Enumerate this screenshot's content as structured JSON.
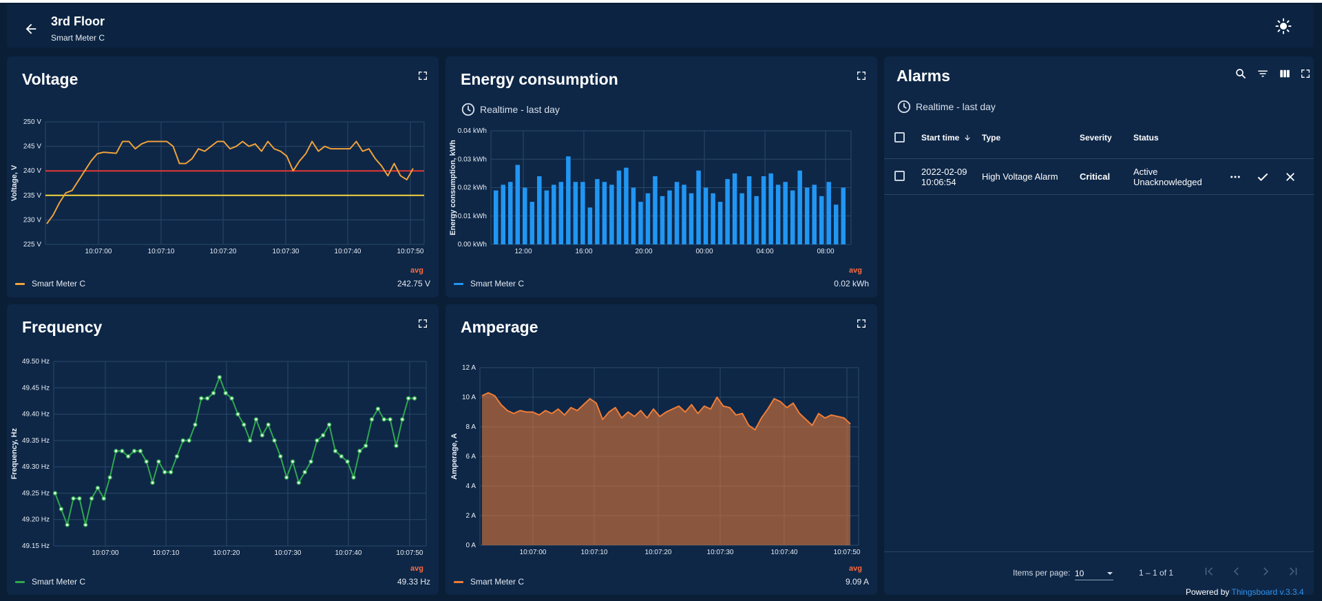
{
  "header": {
    "title": "3rd Floor",
    "subtitle": "Smart Meter C"
  },
  "voltage": {
    "title": "Voltage",
    "legend_name": "Smart Meter C",
    "avg_label": "avg",
    "avg_value": "242.75 V",
    "colors": {
      "line": "#f0a23a",
      "threshold_high": "#e53935",
      "threshold_low": "#f5d63d"
    }
  },
  "energy": {
    "title": "Energy consumption",
    "timewindow": "Realtime - last day",
    "legend_name": "Smart Meter C",
    "avg_label": "avg",
    "avg_value": "0.02 kWh",
    "color": "#2196f3"
  },
  "frequency": {
    "title": "Frequency",
    "legend_name": "Smart Meter C",
    "avg_label": "avg",
    "avg_value": "49.33 Hz",
    "color": "#2fa84f"
  },
  "amperage": {
    "title": "Amperage",
    "legend_name": "Smart Meter C",
    "avg_label": "avg",
    "avg_value": "9.09 A",
    "color": "#f07d37"
  },
  "alarms": {
    "title": "Alarms",
    "timewindow": "Realtime - last day",
    "columns": [
      "Start time",
      "Type",
      "Severity",
      "Status"
    ],
    "rows": [
      {
        "date": "2022-02-09",
        "time": "10:06:54",
        "type": "High Voltage Alarm",
        "severity": "Critical",
        "status_1": "Active",
        "status_2": "Unacknowledged"
      }
    ],
    "pager": {
      "items_per_page_label": "Items per page:",
      "items_per_page": "10",
      "range": "1 – 1 of 1"
    }
  },
  "footer": {
    "powered_prefix": "Powered by",
    "powered_link": "Thingsboard v.3.3.4"
  },
  "chart_data": [
    {
      "type": "line",
      "title": "Voltage",
      "ylabel": "Voltage, V",
      "ylim": [
        225,
        250
      ],
      "yticks": [
        "225 V",
        "230 V",
        "235 V",
        "240 V",
        "245 V",
        "250 V"
      ],
      "xticks": [
        "10:07:00",
        "10:07:10",
        "10:07:20",
        "10:07:30",
        "10:07:40",
        "10:07:50"
      ],
      "x_range": [
        "10:06:52",
        "10:07:51"
      ],
      "series": [
        {
          "name": "Smart Meter C",
          "values": [
            229.2,
            231,
            233.5,
            235.5,
            236,
            238,
            240,
            242,
            243.5,
            243.8,
            243.7,
            243.6,
            246,
            246,
            244.5,
            245.5,
            246,
            246,
            246,
            246,
            245,
            241.5,
            241.5,
            242.5,
            244.5,
            244,
            245,
            246,
            246,
            244.5,
            245,
            246,
            245,
            245.5,
            244,
            246,
            244.5,
            244,
            243,
            240,
            242,
            243.5,
            246,
            244,
            245,
            244.5,
            244.5,
            244.5,
            244.5,
            246,
            244,
            244.5,
            242.5,
            241,
            239,
            241.5,
            239,
            238.2,
            240.5
          ]
        }
      ],
      "thresholds": [
        240,
        235
      ],
      "grid": true,
      "legend": "bottom"
    },
    {
      "type": "bar",
      "title": "Energy consumption",
      "ylabel": "Energy consumption, kWh",
      "ylim": [
        0,
        0.04
      ],
      "yticks": [
        "0.00 kWh",
        "0.01 kWh",
        "0.02 kWh",
        "0.03 kWh",
        "0.04 kWh"
      ],
      "xticks": [
        "12:00",
        "16:00",
        "20:00",
        "00:00",
        "04:00",
        "08:00"
      ],
      "series": [
        {
          "name": "Smart Meter C",
          "values": [
            0.019,
            0.021,
            0.022,
            0.028,
            0.02,
            0.015,
            0.024,
            0.019,
            0.021,
            0.022,
            0.031,
            0.022,
            0.022,
            0.013,
            0.023,
            0.022,
            0.021,
            0.026,
            0.027,
            0.02,
            0.015,
            0.018,
            0.024,
            0.017,
            0.019,
            0.022,
            0.021,
            0.018,
            0.026,
            0.02,
            0.018,
            0.015,
            0.023,
            0.025,
            0.018,
            0.024,
            0.017,
            0.024,
            0.025,
            0.021,
            0.022,
            0.019,
            0.026,
            0.02,
            0.021,
            0.017,
            0.022,
            0.014,
            0.02
          ]
        }
      ],
      "grid": true,
      "legend": "bottom"
    },
    {
      "type": "line",
      "title": "Frequency",
      "ylabel": "Frequency, Hz",
      "ylim": [
        49.15,
        49.5
      ],
      "yticks": [
        "49.15 Hz",
        "49.20 Hz",
        "49.25 Hz",
        "49.30 Hz",
        "49.35 Hz",
        "49.40 Hz",
        "49.45 Hz",
        "49.50 Hz"
      ],
      "xticks": [
        "10:07:00",
        "10:07:10",
        "10:07:20",
        "10:07:30",
        "10:07:40",
        "10:07:50"
      ],
      "series": [
        {
          "name": "Smart Meter C",
          "values": [
            49.25,
            49.22,
            49.19,
            49.24,
            49.24,
            49.19,
            49.24,
            49.26,
            49.24,
            49.28,
            49.33,
            49.33,
            49.32,
            49.33,
            49.33,
            49.31,
            49.27,
            49.31,
            49.29,
            49.29,
            49.32,
            49.35,
            49.35,
            49.38,
            49.43,
            49.43,
            49.44,
            49.47,
            49.44,
            49.43,
            49.4,
            49.38,
            49.35,
            49.39,
            49.36,
            49.38,
            49.35,
            49.32,
            49.28,
            49.31,
            49.27,
            49.29,
            49.31,
            49.35,
            49.36,
            49.38,
            49.33,
            49.32,
            49.31,
            49.28,
            49.33,
            49.34,
            49.39,
            49.41,
            49.39,
            49.39,
            49.34,
            49.39,
            49.43,
            49.43
          ]
        }
      ],
      "grid": true,
      "legend": "bottom"
    },
    {
      "type": "area",
      "title": "Amperage",
      "ylabel": "Amperage, A",
      "ylim": [
        0,
        12
      ],
      "yticks": [
        "0 A",
        "2 A",
        "4 A",
        "6 A",
        "8 A",
        "10 A",
        "12 A"
      ],
      "xticks": [
        "10:07:00",
        "10:07:10",
        "10:07:20",
        "10:07:30",
        "10:07:40",
        "10:07:50"
      ],
      "series": [
        {
          "name": "Smart Meter C",
          "values": [
            10.1,
            10.3,
            10.1,
            9.5,
            9.1,
            8.9,
            9.1,
            9.0,
            9.0,
            8.8,
            9.1,
            8.9,
            9.2,
            8.8,
            9.3,
            9.1,
            9.5,
            9.9,
            9.6,
            8.5,
            9.0,
            9.3,
            8.6,
            9.0,
            8.7,
            9.1,
            8.6,
            9.2,
            8.7,
            9.0,
            9.2,
            9.4,
            9.0,
            9.5,
            8.9,
            9.4,
            9.2,
            10.0,
            9.4,
            9.3,
            8.8,
            8.9,
            8.1,
            7.8,
            8.6,
            9.2,
            9.9,
            9.7,
            9.3,
            9.6,
            8.9,
            8.5,
            8.1,
            8.9,
            8.6,
            8.8,
            8.7,
            8.6,
            8.2
          ]
        }
      ],
      "grid": true,
      "legend": "bottom"
    }
  ]
}
